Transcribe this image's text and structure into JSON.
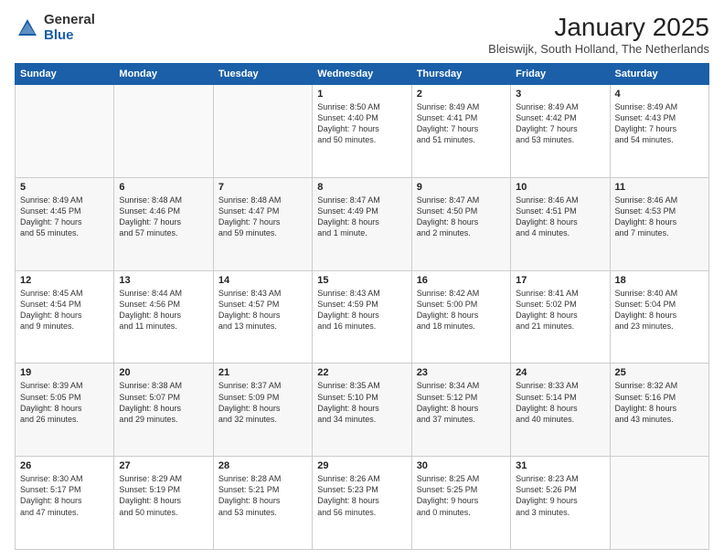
{
  "header": {
    "logo_general": "General",
    "logo_blue": "Blue",
    "month_title": "January 2025",
    "location": "Bleiswijk, South Holland, The Netherlands"
  },
  "days_of_week": [
    "Sunday",
    "Monday",
    "Tuesday",
    "Wednesday",
    "Thursday",
    "Friday",
    "Saturday"
  ],
  "weeks": [
    [
      {
        "num": "",
        "content": ""
      },
      {
        "num": "",
        "content": ""
      },
      {
        "num": "",
        "content": ""
      },
      {
        "num": "1",
        "content": "Sunrise: 8:50 AM\nSunset: 4:40 PM\nDaylight: 7 hours\nand 50 minutes."
      },
      {
        "num": "2",
        "content": "Sunrise: 8:49 AM\nSunset: 4:41 PM\nDaylight: 7 hours\nand 51 minutes."
      },
      {
        "num": "3",
        "content": "Sunrise: 8:49 AM\nSunset: 4:42 PM\nDaylight: 7 hours\nand 53 minutes."
      },
      {
        "num": "4",
        "content": "Sunrise: 8:49 AM\nSunset: 4:43 PM\nDaylight: 7 hours\nand 54 minutes."
      }
    ],
    [
      {
        "num": "5",
        "content": "Sunrise: 8:49 AM\nSunset: 4:45 PM\nDaylight: 7 hours\nand 55 minutes."
      },
      {
        "num": "6",
        "content": "Sunrise: 8:48 AM\nSunset: 4:46 PM\nDaylight: 7 hours\nand 57 minutes."
      },
      {
        "num": "7",
        "content": "Sunrise: 8:48 AM\nSunset: 4:47 PM\nDaylight: 7 hours\nand 59 minutes."
      },
      {
        "num": "8",
        "content": "Sunrise: 8:47 AM\nSunset: 4:49 PM\nDaylight: 8 hours\nand 1 minute."
      },
      {
        "num": "9",
        "content": "Sunrise: 8:47 AM\nSunset: 4:50 PM\nDaylight: 8 hours\nand 2 minutes."
      },
      {
        "num": "10",
        "content": "Sunrise: 8:46 AM\nSunset: 4:51 PM\nDaylight: 8 hours\nand 4 minutes."
      },
      {
        "num": "11",
        "content": "Sunrise: 8:46 AM\nSunset: 4:53 PM\nDaylight: 8 hours\nand 7 minutes."
      }
    ],
    [
      {
        "num": "12",
        "content": "Sunrise: 8:45 AM\nSunset: 4:54 PM\nDaylight: 8 hours\nand 9 minutes."
      },
      {
        "num": "13",
        "content": "Sunrise: 8:44 AM\nSunset: 4:56 PM\nDaylight: 8 hours\nand 11 minutes."
      },
      {
        "num": "14",
        "content": "Sunrise: 8:43 AM\nSunset: 4:57 PM\nDaylight: 8 hours\nand 13 minutes."
      },
      {
        "num": "15",
        "content": "Sunrise: 8:43 AM\nSunset: 4:59 PM\nDaylight: 8 hours\nand 16 minutes."
      },
      {
        "num": "16",
        "content": "Sunrise: 8:42 AM\nSunset: 5:00 PM\nDaylight: 8 hours\nand 18 minutes."
      },
      {
        "num": "17",
        "content": "Sunrise: 8:41 AM\nSunset: 5:02 PM\nDaylight: 8 hours\nand 21 minutes."
      },
      {
        "num": "18",
        "content": "Sunrise: 8:40 AM\nSunset: 5:04 PM\nDaylight: 8 hours\nand 23 minutes."
      }
    ],
    [
      {
        "num": "19",
        "content": "Sunrise: 8:39 AM\nSunset: 5:05 PM\nDaylight: 8 hours\nand 26 minutes."
      },
      {
        "num": "20",
        "content": "Sunrise: 8:38 AM\nSunset: 5:07 PM\nDaylight: 8 hours\nand 29 minutes."
      },
      {
        "num": "21",
        "content": "Sunrise: 8:37 AM\nSunset: 5:09 PM\nDaylight: 8 hours\nand 32 minutes."
      },
      {
        "num": "22",
        "content": "Sunrise: 8:35 AM\nSunset: 5:10 PM\nDaylight: 8 hours\nand 34 minutes."
      },
      {
        "num": "23",
        "content": "Sunrise: 8:34 AM\nSunset: 5:12 PM\nDaylight: 8 hours\nand 37 minutes."
      },
      {
        "num": "24",
        "content": "Sunrise: 8:33 AM\nSunset: 5:14 PM\nDaylight: 8 hours\nand 40 minutes."
      },
      {
        "num": "25",
        "content": "Sunrise: 8:32 AM\nSunset: 5:16 PM\nDaylight: 8 hours\nand 43 minutes."
      }
    ],
    [
      {
        "num": "26",
        "content": "Sunrise: 8:30 AM\nSunset: 5:17 PM\nDaylight: 8 hours\nand 47 minutes."
      },
      {
        "num": "27",
        "content": "Sunrise: 8:29 AM\nSunset: 5:19 PM\nDaylight: 8 hours\nand 50 minutes."
      },
      {
        "num": "28",
        "content": "Sunrise: 8:28 AM\nSunset: 5:21 PM\nDaylight: 8 hours\nand 53 minutes."
      },
      {
        "num": "29",
        "content": "Sunrise: 8:26 AM\nSunset: 5:23 PM\nDaylight: 8 hours\nand 56 minutes."
      },
      {
        "num": "30",
        "content": "Sunrise: 8:25 AM\nSunset: 5:25 PM\nDaylight: 9 hours\nand 0 minutes."
      },
      {
        "num": "31",
        "content": "Sunrise: 8:23 AM\nSunset: 5:26 PM\nDaylight: 9 hours\nand 3 minutes."
      },
      {
        "num": "",
        "content": ""
      }
    ]
  ]
}
